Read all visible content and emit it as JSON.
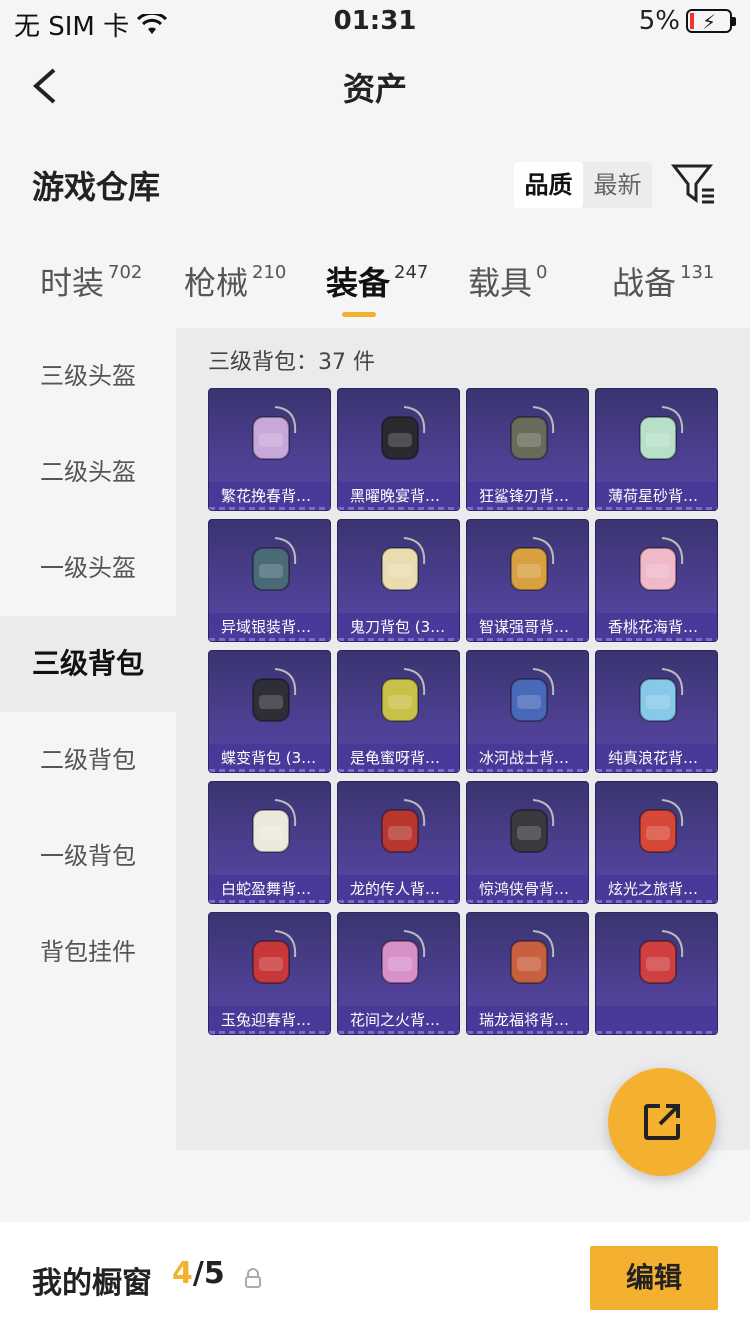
{
  "status_bar": {
    "carrier": "无 SIM 卡",
    "time": "01:31",
    "battery": "5%",
    "battery_level": 0.05
  },
  "nav": {
    "title": "资产"
  },
  "header": {
    "title": "游戏仓库",
    "sort": {
      "quality": "品质",
      "latest": "最新"
    }
  },
  "tabs": [
    {
      "label": "时装",
      "count": "702"
    },
    {
      "label": "枪械",
      "count": "210"
    },
    {
      "label": "装备",
      "count": "247"
    },
    {
      "label": "载具",
      "count": "0"
    },
    {
      "label": "战备",
      "count": "131"
    }
  ],
  "sidebar": {
    "items": [
      {
        "label": "三级头盔"
      },
      {
        "label": "二级头盔"
      },
      {
        "label": "一级头盔"
      },
      {
        "label": "三级背包"
      },
      {
        "label": "二级背包"
      },
      {
        "label": "一级背包"
      },
      {
        "label": "背包挂件"
      }
    ]
  },
  "content": {
    "count_label": "三级背包：37 件",
    "items": [
      {
        "label": "繁花挽春背…",
        "color": "#c8a8d8"
      },
      {
        "label": "黑曜晚宴背…",
        "color": "#2a2a2e"
      },
      {
        "label": "狂鲨锋刃背…",
        "color": "#6a6a5a"
      },
      {
        "label": "薄荷星砂背…",
        "color": "#b8e0c8"
      },
      {
        "label": "异域银装背…",
        "color": "#4a6a78"
      },
      {
        "label": "鬼刀背包 (3…",
        "color": "#e8dcb0"
      },
      {
        "label": "智谋强哥背…",
        "color": "#d8a040"
      },
      {
        "label": "香桃花海背…",
        "color": "#f0b8c8"
      },
      {
        "label": "蝶变背包 (3…",
        "color": "#2e2e36"
      },
      {
        "label": "是龟蜜呀背…",
        "color": "#c8c048"
      },
      {
        "label": "冰河战士背…",
        "color": "#4868b8"
      },
      {
        "label": "纯真浪花背…",
        "color": "#88c8e8"
      },
      {
        "label": "白蛇盈舞背…",
        "color": "#ece8dc"
      },
      {
        "label": "龙的传人背…",
        "color": "#b83830"
      },
      {
        "label": "惊鸿侠骨背…",
        "color": "#3a3a3e"
      },
      {
        "label": "炫光之旅背…",
        "color": "#d84838"
      },
      {
        "label": "玉兔迎春背…",
        "color": "#c83838"
      },
      {
        "label": "花间之火背…",
        "color": "#d890c8"
      },
      {
        "label": "瑞龙福将背…",
        "color": "#c86040"
      },
      {
        "label": "",
        "color": "#d04040"
      }
    ]
  },
  "showcase": {
    "label": "我的橱窗",
    "current": "4",
    "total": "/5",
    "edit": "编辑"
  },
  "colors": {
    "accent": "#f4b12f",
    "card_bg": "#4c3f90"
  }
}
